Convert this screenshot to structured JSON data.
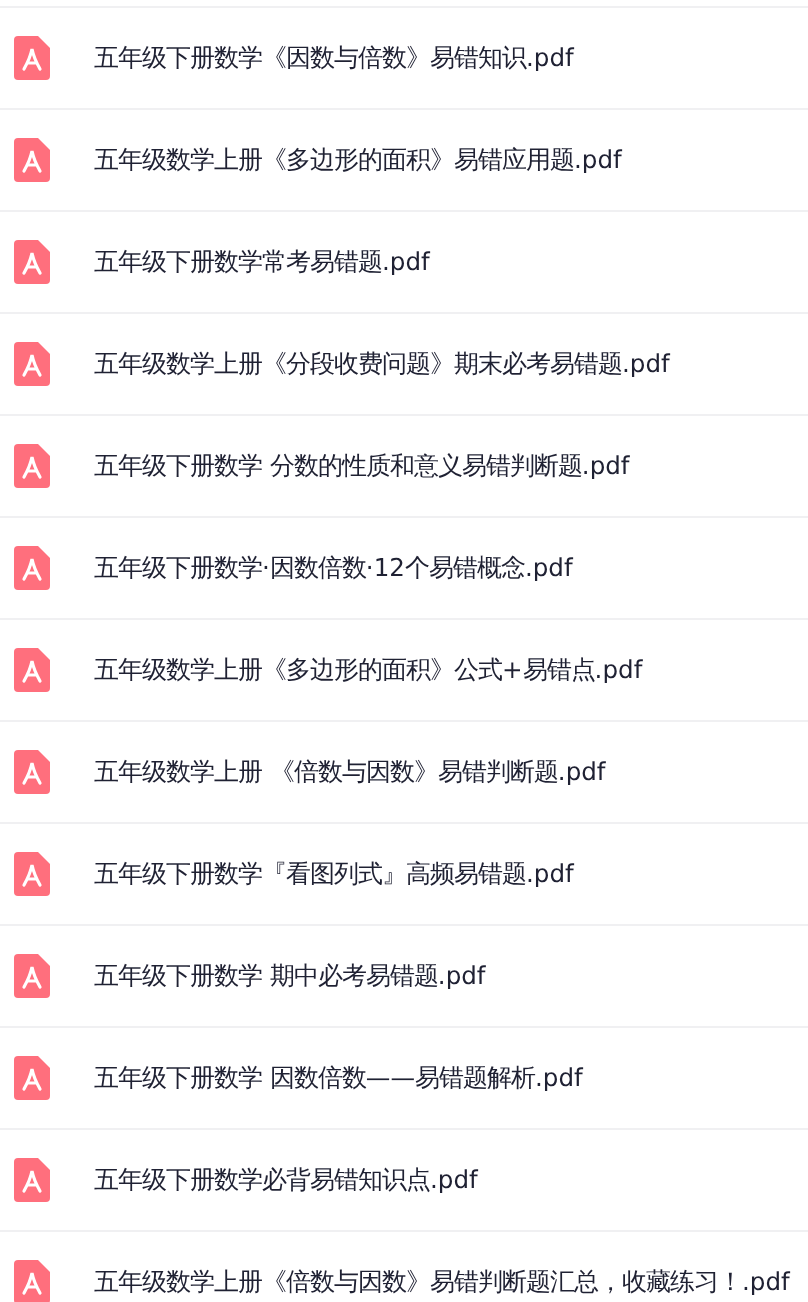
{
  "files": [
    {
      "name": "五年级下册数学《因数与倍数》易错知识.pdf"
    },
    {
      "name": "五年级数学上册《多边形的面积》易错应用题.pdf"
    },
    {
      "name": "五年级下册数学常考易错题.pdf"
    },
    {
      "name": "五年级数学上册《分段收费问题》期末必考易错题.pdf"
    },
    {
      "name": "五年级下册数学 分数的性质和意义易错判断题.pdf"
    },
    {
      "name": "五年级下册数学·因数倍数·12个易错概念.pdf"
    },
    {
      "name": "五年级数学上册《多边形的面积》公式+易错点.pdf"
    },
    {
      "name": "五年级数学上册 《倍数与因数》易错判断题.pdf"
    },
    {
      "name": "五年级下册数学『看图列式』高频易错题.pdf"
    },
    {
      "name": "五年级下册数学 期中必考易错题.pdf"
    },
    {
      "name": "五年级下册数学 因数倍数——易错题解析.pdf"
    },
    {
      "name": "五年级下册数学必背易错知识点.pdf"
    },
    {
      "name": "五年级数学上册《倍数与因数》易错判断题汇总，收藏练习！.pdf"
    }
  ]
}
